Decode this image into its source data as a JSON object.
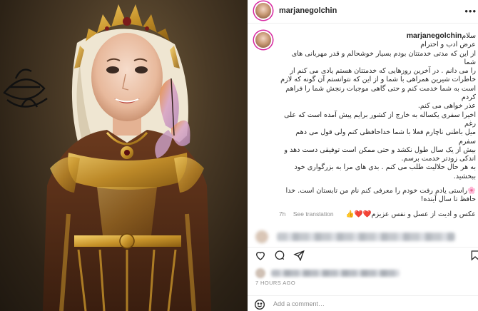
{
  "post": {
    "username": "marjanegolchin",
    "caption_lines": [
      "سلام",
      "عرض ادب و احترام",
      "از این که مدتی خدمتتان بودم بسیار خوشحالم و قدر مهربانی های شما",
      "را می دانم . در آخرین روزهایی که خدمتتان هستم یادی می کنم از",
      "خاطرات شیرین همراهی با شما و از این که نتوانستم آن گونه که لازم",
      "است به شما خدمت کنم و حتی گاهی موجبات رنجش شما را فراهم کردم",
      "عذر خواهی می کنم.",
      "اخیرا سفری یکساله به خارج از کشور برایم پیش آمده است که علی رغم",
      "میل باطنی ناچارم فعلا با شما خداحافظی کنم ولی قول می دهم سفرم",
      "بیش از یک سال طول نکشد و حتی ممکن است توفیقی دست دهد و",
      "اندکی زودتر خدمت برسم.",
      "به هر حال حلالیت طلب می کنم . بدی های مرا به بزرگواری خود ببخشید.",
      "🌸راستی یادم رفت خودم را معرفی کنم نام من تابستان است. خدا",
      "حافظ تا سال آینده!",
      "عکس و ادیت از عسل و نفس عزیزم❤️❤️👍"
    ],
    "caption_time": "7h",
    "see_translation": "See translation",
    "timestamp": "7 HOURS AGO",
    "comment_placeholder": "Add a comment…"
  },
  "icons": {
    "more": "more-options-icon",
    "like": "heart-icon",
    "comment": "comment-icon",
    "share": "share-icon",
    "save": "bookmark-icon",
    "emoji": "emoji-icon"
  },
  "colors": {
    "story_ring": "#d6249f",
    "muted_text": "#8e8e8e",
    "border": "#efefef"
  }
}
